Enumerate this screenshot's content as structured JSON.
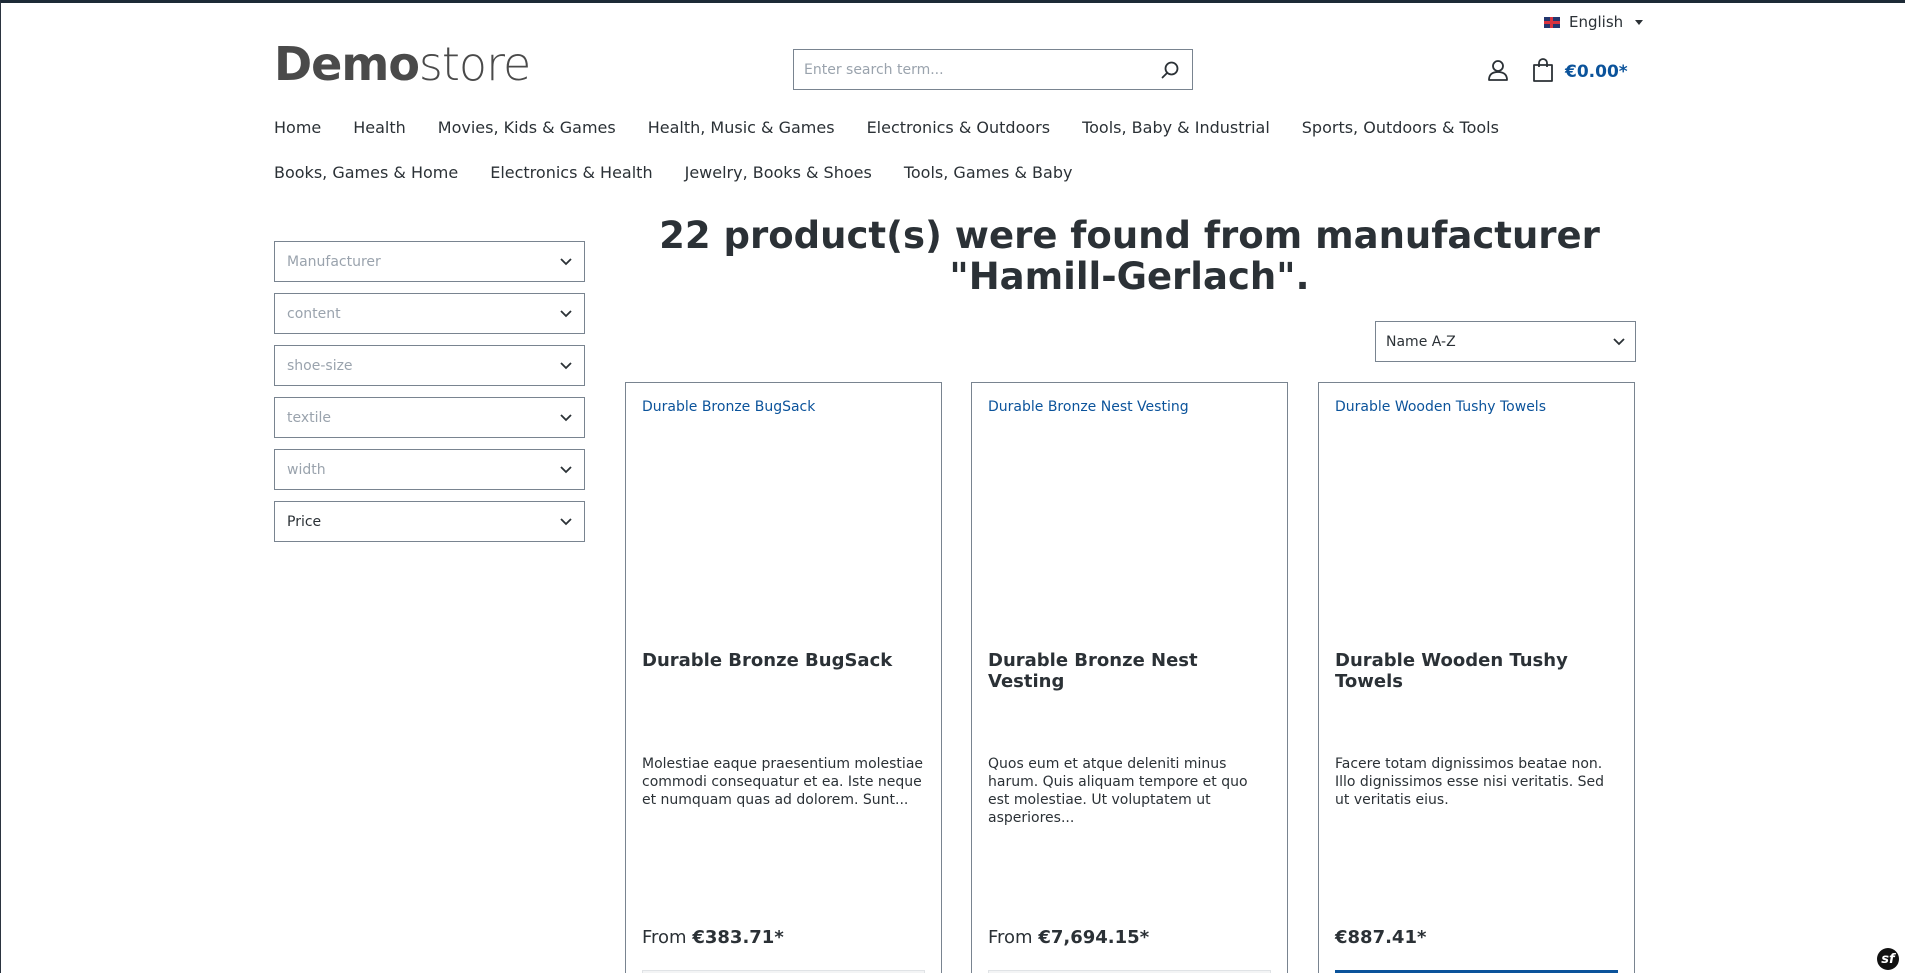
{
  "topbar": {
    "language": "English"
  },
  "header": {
    "logo_bold": "Demo",
    "logo_light": "store",
    "search_placeholder": "Enter search term...",
    "cart_total": "€0.00*"
  },
  "nav": {
    "row1": [
      "Home",
      "Health",
      "Movies, Kids & Games",
      "Health, Music & Games",
      "Electronics & Outdoors",
      "Tools, Baby & Industrial",
      "Sports, Outdoors & Tools"
    ],
    "row2": [
      "Books, Games & Home",
      "Electronics & Health",
      "Jewelry, Books & Shoes",
      "Tools, Games & Baby"
    ]
  },
  "filters": [
    "Manufacturer",
    "content",
    "shoe-size",
    "textile",
    "width",
    "Price"
  ],
  "listing": {
    "title": "22 product(s) were found from manufacturer \"Hamill-Gerlach\".",
    "sort_value": "Name A-Z"
  },
  "products": [
    {
      "image_alt": "Durable Bronze BugSack",
      "name": "Durable Bronze BugSack",
      "description": "Molestiae eaque praesentium molestiae commodi consequatur et ea. Iste neque et numquam quas ad dolorem. Sunt...",
      "price_prefix": "From",
      "price": "€383.71*"
    },
    {
      "image_alt": "Durable Bronze Nest Vesting",
      "name": "Durable Bronze Nest Vesting",
      "description": "Quos eum et atque deleniti minus harum. Quis aliquam tempore et quo est molestiae. Ut voluptatem ut asperiores...",
      "price_prefix": "From",
      "price": "€7,694.15*"
    },
    {
      "image_alt": "Durable Wooden Tushy Towels",
      "name": "Durable Wooden Tushy Towels",
      "description": "Facere totam dignissimos beatae non. Illo dignissimos esse nisi veritatis. Sed ut veritatis eius.",
      "price_prefix": "",
      "price": "€887.41*"
    }
  ],
  "colors": {
    "accent": "#0b539b",
    "text": "#2b3136",
    "border": "#798490"
  }
}
